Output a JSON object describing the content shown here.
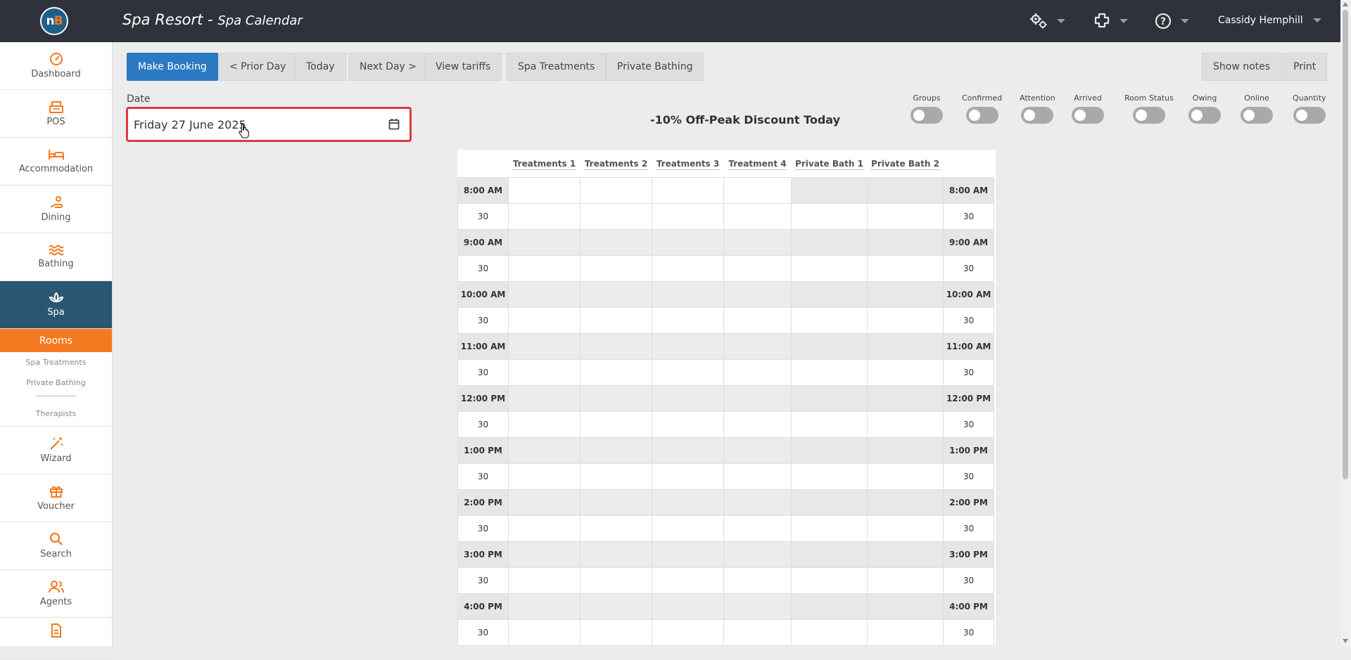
{
  "header": {
    "app_name": "Spa Resort",
    "separator": " - ",
    "page_name": "Spa Calendar",
    "user_name": "Cassidy Hemphill"
  },
  "sidebar": {
    "items": [
      {
        "label": "Dashboard",
        "icon": "dashboard-icon"
      },
      {
        "label": "POS",
        "icon": "pos-icon"
      },
      {
        "label": "Accommodation",
        "icon": "bed-icon"
      },
      {
        "label": "Dining",
        "icon": "dining-icon"
      },
      {
        "label": "Bathing",
        "icon": "waves-icon"
      },
      {
        "label": "Spa",
        "icon": "lotus-icon"
      }
    ],
    "spa_submenu": {
      "active": "Rooms",
      "items": [
        "Spa Treatments",
        "Private Bathing"
      ],
      "after_separator": "Therapists"
    },
    "items_after": [
      {
        "label": "Wizard",
        "icon": "wand-icon"
      },
      {
        "label": "Voucher",
        "icon": "gift-icon"
      },
      {
        "label": "Search",
        "icon": "search-icon"
      },
      {
        "label": "Agents",
        "icon": "agents-icon"
      }
    ]
  },
  "toolbar": {
    "make_booking": "Make Booking",
    "prior_day": "< Prior Day",
    "today": "Today",
    "next_day": "Next Day >",
    "view_tariffs": "View tariffs",
    "spa_treatments": "Spa Treatments",
    "private_bathing": "Private Bathing",
    "show_notes": "Show notes",
    "print": "Print"
  },
  "date": {
    "label": "Date",
    "value": "Friday 27 June 2025"
  },
  "discount_banner": "-10% Off-Peak Discount Today",
  "toggles": [
    "Groups",
    "Confirmed",
    "Attention",
    "Arrived",
    "Room Status",
    "Owing",
    "Online",
    "Quantity"
  ],
  "calendar": {
    "columns": [
      "Treatments 1",
      "Treatments 2",
      "Treatments 3",
      "Treatment 4",
      "Private Bath 1",
      "Private Bath 2"
    ],
    "rows": [
      "8:00 AM",
      "30",
      "9:00 AM",
      "30",
      "10:00 AM",
      "30",
      "11:00 AM",
      "30",
      "12:00 PM",
      "30",
      "1:00 PM",
      "30",
      "2:00 PM",
      "30",
      "3:00 PM",
      "30",
      "4:00 PM",
      "30"
    ]
  },
  "colors": {
    "topbar": "#2f323b",
    "sidebar_active": "#2a5673",
    "accent_orange": "#f47920",
    "primary_button": "#2b79c2",
    "highlight_border": "#e0393e"
  }
}
